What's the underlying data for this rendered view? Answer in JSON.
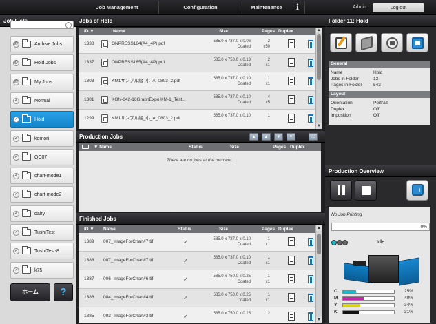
{
  "topbar": {
    "job_management": "Job Management",
    "configuration": "Configuration",
    "maintenance": "Maintenance",
    "info_glyph": "i",
    "user": "Admin",
    "logout": "Log out"
  },
  "left": {
    "title": "Job Lists",
    "items": [
      {
        "label": "Archive Jobs"
      },
      {
        "label": "Hold Jobs"
      },
      {
        "label": "My Jobs"
      },
      {
        "label": "Normal"
      },
      {
        "label": "Hold"
      },
      {
        "label": "komori"
      },
      {
        "label": "QC07"
      },
      {
        "label": "chart-mode1"
      },
      {
        "label": "chart-mode2"
      },
      {
        "label": "dairy"
      },
      {
        "label": "TushiTest"
      },
      {
        "label": "TushiTest-8"
      },
      {
        "label": "k75"
      }
    ],
    "home_label": "ホーム",
    "help_label": "?"
  },
  "hold": {
    "title": "Jobs of Hold",
    "columns": {
      "id": "ID ▼",
      "name": "Name",
      "size": "Size",
      "pages": "Pages",
      "duplex": "Duplex"
    },
    "rows": [
      {
        "id": "1338",
        "name": "ONPRESS184(A4_4P).pdf",
        "size": "585.0 x 737.0 x 0.06",
        "media": "Coated",
        "pages": "2",
        "copies": "x50"
      },
      {
        "id": "1337",
        "name": "ONPRESS185(A4_4P).pdf",
        "size": "585.0 x 750.0 x 0.13",
        "media": "Coated",
        "pages": "2",
        "copies": "x1"
      },
      {
        "id": "1303",
        "name": "KM1サンプル綴_小_A_0803_2.pdf",
        "size": "585.0 x 737.0 x 0.10",
        "media": "Coated",
        "pages": "1",
        "copies": "x1"
      },
      {
        "id": "1301",
        "name": "KON-642-16GraphExpo KM-1_Test...",
        "size": "585.0 x 737.0 x 0.10",
        "media": "Coated",
        "pages": "4",
        "copies": "x5"
      },
      {
        "id": "1299",
        "name": "KM1サンプル綴_小_A_0803_2.pdf",
        "size": "585.0 x 737.0 x 0.10",
        "media": "",
        "pages": "1",
        "copies": ""
      }
    ]
  },
  "production": {
    "title": "Production Jobs",
    "columns": {
      "name": "▼ Name",
      "status": "Status",
      "size": "Size",
      "pages": "Pages",
      "duplex": "Duplex"
    },
    "empty": "There are no jobs at the moment."
  },
  "finished": {
    "title": "Finished Jobs",
    "columns": {
      "id": "ID ▼",
      "name": "Name",
      "status": "Status",
      "size": "Size",
      "pages": "Pages",
      "duplex": "Duplex"
    },
    "rows": [
      {
        "id": "1389",
        "name": "007_ImageForChart#7.tif",
        "status": "✓",
        "size": "585.0 x 737.0 x 0.10",
        "media": "Coated",
        "pages": "1",
        "copies": "x1"
      },
      {
        "id": "1388",
        "name": "007_ImageForChart#7.tif",
        "status": "✓",
        "size": "585.0 x 737.0 x 0.10",
        "media": "Coated",
        "pages": "1",
        "copies": "x1"
      },
      {
        "id": "1387",
        "name": "006_ImageForChart#6.tif",
        "status": "✓",
        "size": "585.0 x 750.0 x 0.25",
        "media": "Coated",
        "pages": "1",
        "copies": "x1"
      },
      {
        "id": "1386",
        "name": "004_ImageForChart#4.tif",
        "status": "✓",
        "size": "585.0 x 750.0 x 0.25",
        "media": "Coated",
        "pages": "1",
        "copies": "x1"
      },
      {
        "id": "1385",
        "name": "003_ImageForChart#3.tif",
        "status": "✓",
        "size": "585.0 x 750.0 x 0.25",
        "media": "",
        "pages": "2",
        "copies": ""
      }
    ]
  },
  "folder": {
    "title": "Folder 11: Hold",
    "general_head": "General",
    "name_key": "Name",
    "name_val": "Hold",
    "jobs_key": "Jobs in Folder",
    "jobs_val": "13",
    "pages_key": "Pages in Folder",
    "pages_val": "543",
    "layout_head": "Layout",
    "orient_key": "Orientation",
    "orient_val": "Portrait",
    "duplex_key": "Duplex",
    "duplex_val": "Off",
    "imposition_key": "Imposition",
    "imposition_val": "Off"
  },
  "overview": {
    "title": "Production Overview",
    "no_job": "No Job Printing",
    "progress": "0%",
    "progress_value": 0,
    "status": "Idle",
    "toner": [
      {
        "label": "C",
        "value": 25,
        "text": "25%",
        "color": "#19b8c9"
      },
      {
        "label": "M",
        "value": 40,
        "text": "40%",
        "color": "#c02aa6"
      },
      {
        "label": "Y",
        "value": 34,
        "text": "34%",
        "color": "#d7d21b"
      },
      {
        "label": "K",
        "value": 31,
        "text": "31%",
        "color": "#111111"
      }
    ]
  }
}
